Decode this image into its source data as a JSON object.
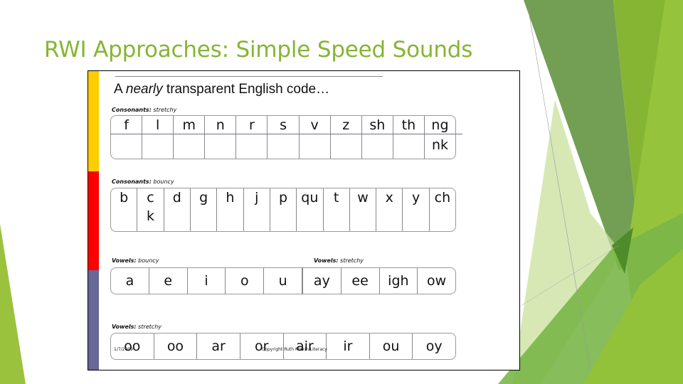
{
  "slide": {
    "title": "RWI Approaches: Simple Speed Sounds",
    "accent_color": "#86b534"
  },
  "chart_image": {
    "heading_prefix": "A ",
    "heading_emphasis": "nearly",
    "heading_suffix": " transparent English code…",
    "strip_colors": [
      "#ffcc00",
      "#ff0000",
      "#676898"
    ],
    "sections": [
      {
        "label_bold": "Consonants:",
        "label_rest": " stretchy",
        "cells": [
          [
            "f"
          ],
          [
            "l"
          ],
          [
            "m"
          ],
          [
            "n"
          ],
          [
            "r"
          ],
          [
            "s"
          ],
          [
            "v"
          ],
          [
            "z"
          ],
          [
            "sh"
          ],
          [
            "th"
          ],
          [
            "ng",
            "nk"
          ]
        ]
      },
      {
        "label_bold": "Consonants:",
        "label_rest": " bouncy",
        "cells": [
          [
            "b"
          ],
          [
            "c",
            "k"
          ],
          [
            "d"
          ],
          [
            "g"
          ],
          [
            "h"
          ],
          [
            "j"
          ],
          [
            "p"
          ],
          [
            "qu"
          ],
          [
            "t"
          ],
          [
            "w"
          ],
          [
            "x"
          ],
          [
            "y"
          ],
          [
            "ch"
          ]
        ]
      },
      {
        "label_bold": "Vowels:",
        "label_rest": " bouncy",
        "cells": [
          [
            "a"
          ],
          [
            "e"
          ],
          [
            "i"
          ],
          [
            "o"
          ],
          [
            "u"
          ]
        ]
      },
      {
        "label_bold": "Vowels:",
        "label_rest": " stretchy",
        "cells": [
          [
            "ay"
          ],
          [
            "ee"
          ],
          [
            "igh"
          ],
          [
            "ow"
          ]
        ]
      },
      {
        "label_bold": "Vowels:",
        "label_rest": " stretchy",
        "cells": [
          [
            "oo"
          ],
          [
            "oo"
          ],
          [
            "ar"
          ],
          [
            "or"
          ],
          [
            "air"
          ],
          [
            "ir"
          ],
          [
            "ou"
          ],
          [
            "oy"
          ]
        ]
      }
    ],
    "footer_date": "1/7/2009",
    "footer_copyright": "Copyright Ruth Miskin Literacy"
  }
}
